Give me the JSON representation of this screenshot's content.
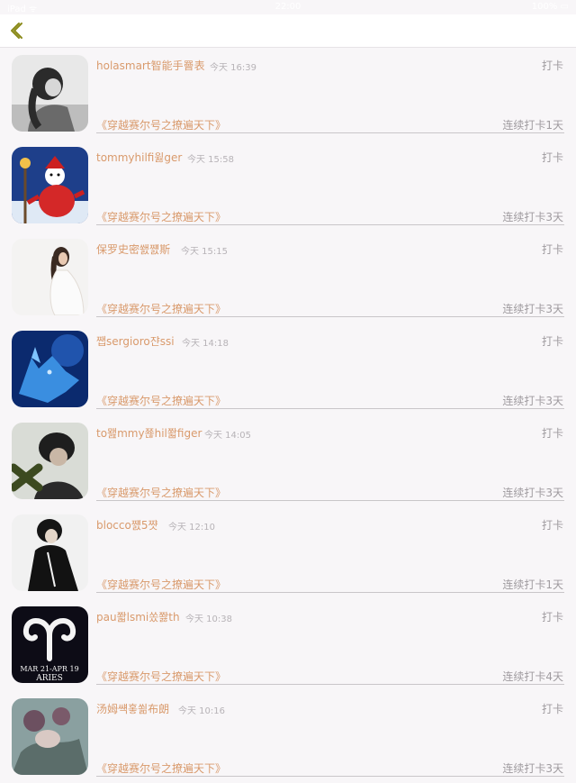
{
  "status_bar": {
    "left": "iPad ᯤ",
    "time": "22:00",
    "right": "100% ▭"
  },
  "nav": {
    "back_icon": "chevron-left-icon",
    "accent": "#8a8a1a"
  },
  "colors": {
    "name": "#d99a6c",
    "muted": "#9f9b9f",
    "time": "#b7b3b7"
  },
  "checkins": [
    {
      "name": "holasmart智能手罾表",
      "time": "今天 16:39",
      "action": "打卡",
      "book": "《穿越赛尔号之撩遍天下》",
      "streak": "连续打卡1天",
      "avatar": "girl-grayscale"
    },
    {
      "name": "tommyhilfi윓ger",
      "time": "今天 15:58",
      "action": "打卡",
      "book": "《穿越赛尔号之撩遍天下》",
      "streak": "连续打卡3天",
      "avatar": "snowman"
    },
    {
      "name": "保罗史密쐜쨼斯",
      "time": "今天 15:15",
      "action": "打卡",
      "book": "《穿越赛尔号之撩遍天下》",
      "streak": "连续打卡3天",
      "avatar": "girl-white"
    },
    {
      "name": "쨉sergioro쟌ssi",
      "time": "今天 14:18",
      "action": "打卡",
      "book": "《穿越赛尔号之撩遍天下》",
      "streak": "连续打卡3天",
      "avatar": "blue-wolf"
    },
    {
      "name": "to뫮mmy쬲hil쫣figer",
      "time": "今天 14:05",
      "action": "打卡",
      "book": "《穿越赛尔号之撩遍天下》",
      "streak": "连续打卡3天",
      "avatar": "boy-cross"
    },
    {
      "name": "blocco쨼5쨧",
      "time": "今天 12:10",
      "action": "打卡",
      "book": "《穿越赛尔号之撩遍天下》",
      "streak": "连续打卡1天",
      "avatar": "black-figure"
    },
    {
      "name": "pau쫣lsmi쏬쫧th",
      "time": "今天 10:38",
      "action": "打卡",
      "book": "《穿越赛尔号之撩遍天下》",
      "streak": "连续打卡4天",
      "avatar": "aries"
    },
    {
      "name": "汤姆썍홓쐶布朗",
      "time": "今天 10:16",
      "action": "打卡",
      "book": "《穿越赛尔号之撩遍天下》",
      "streak": "连续打卡3天",
      "avatar": "roses"
    }
  ]
}
